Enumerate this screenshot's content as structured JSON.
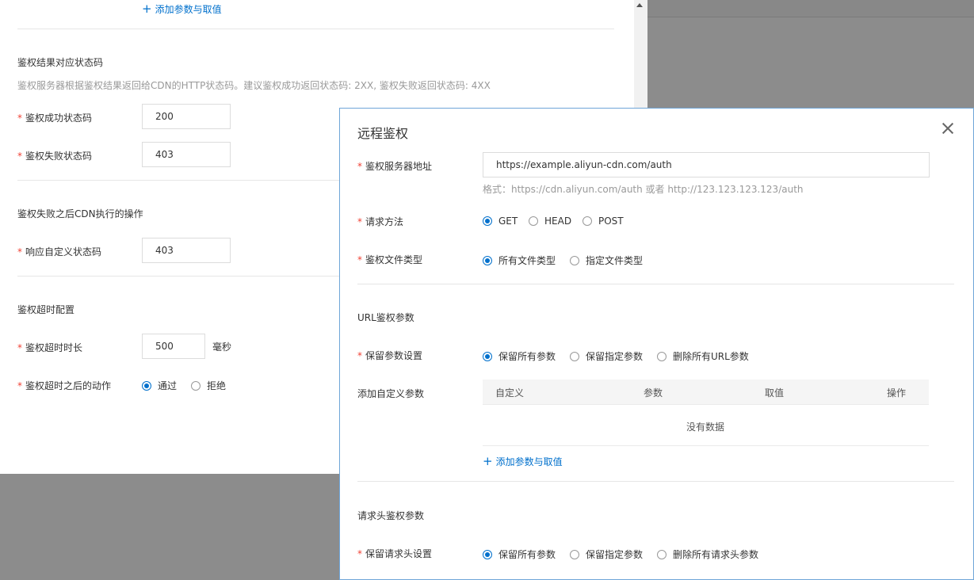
{
  "background": {
    "add_param_link": "添加参数与取值",
    "status_section": {
      "title": "鉴权结果对应状态码",
      "description": "鉴权服务器根据鉴权结果返回给CDN的HTTP状态码。建议鉴权成功返回状态码: 2XX, 鉴权失败返回状态码: 4XX",
      "success_label": "鉴权成功状态码",
      "success_value": "200",
      "fail_label": "鉴权失败状态码",
      "fail_value": "403"
    },
    "fail_section": {
      "title": "鉴权失败之后CDN执行的操作",
      "custom_label": "响应自定义状态码",
      "custom_value": "403"
    },
    "timeout_section": {
      "title": "鉴权超时配置",
      "duration_label": "鉴权超时时长",
      "duration_value": "500",
      "duration_unit": "毫秒",
      "action_label": "鉴权超时之后的动作",
      "options": [
        "通过",
        "拒绝"
      ],
      "selected": "通过"
    }
  },
  "dialog": {
    "title": "远程鉴权",
    "server_label": "鉴权服务器地址",
    "server_value": "https://example.aliyun-cdn.com/auth",
    "server_hint": "格式：https://cdn.aliyun.com/auth 或者 http://123.123.123.123/auth",
    "method_label": "请求方法",
    "methods": [
      "GET",
      "HEAD",
      "POST"
    ],
    "method_selected": "GET",
    "filetype_label": "鉴权文件类型",
    "filetypes": [
      "所有文件类型",
      "指定文件类型"
    ],
    "filetype_selected": "所有文件类型",
    "url_section_title": "URL鉴权参数",
    "keep_param_label": "保留参数设置",
    "keep_param_options": [
      "保留所有参数",
      "保留指定参数",
      "删除所有URL参数"
    ],
    "keep_param_selected": "保留所有参数",
    "custom_param_label": "添加自定义参数",
    "table_headers": [
      "自定义",
      "参数",
      "取值",
      "操作"
    ],
    "table_empty": "没有数据",
    "add_param_link": "添加参数与取值",
    "header_section_title": "请求头鉴权参数",
    "keep_header_label": "保留请求头设置",
    "keep_header_options": [
      "保留所有参数",
      "保留指定参数",
      "删除所有请求头参数"
    ],
    "keep_header_selected": "保留所有参数"
  },
  "colors": {
    "accent": "#0070cc",
    "required": "#f04134",
    "overlay": "#8c8c8c"
  }
}
